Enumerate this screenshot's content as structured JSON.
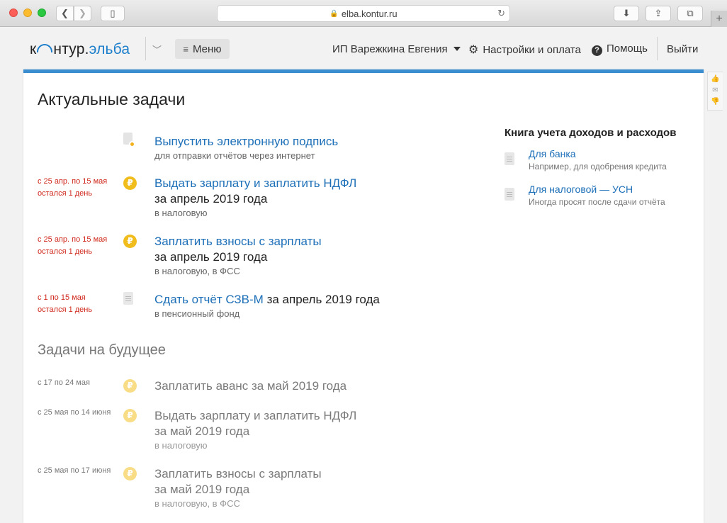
{
  "browser": {
    "url": "elba.kontur.ru",
    "new_tab": "+"
  },
  "header": {
    "logo_part1": "к",
    "logo_part2": "нтур.",
    "logo_part3": "эльба",
    "menu_label": "Меню",
    "user_label": "ИП Варежкина Евгения",
    "settings_label": "Настройки и оплата",
    "help_label": "Помощь",
    "logout_label": "Выйти"
  },
  "main": {
    "title": "Актуальные задачи",
    "tasks": [
      {
        "link": "Выпустить электронную подпись",
        "sub": "для отправки отчётов через интернет"
      },
      {
        "deadline1": "с 25 апр. по 15 мая",
        "deadline2": "остался 1 день",
        "link": "Выдать зарплату и заплатить НДФЛ",
        "main": "за апрель 2019 года",
        "sub": "в налоговую"
      },
      {
        "deadline1": "с 25 апр. по 15 мая",
        "deadline2": "остался 1 день",
        "link": "Заплатить взносы с зарплаты",
        "main": "за апрель 2019 года",
        "sub": "в налоговую, в ФСС"
      },
      {
        "deadline1": "с 1 по 15 мая",
        "deadline2": "остался 1 день",
        "link": "Сдать отчёт СЗВ-М",
        "main_inline": " за апрель 2019 года",
        "sub": "в пенсионный фонд"
      }
    ],
    "future_title": "Задачи на будущее",
    "future_tasks": [
      {
        "deadline": "с 17 по 24 мая",
        "link": "Заплатить аванс за май 2019 года"
      },
      {
        "deadline": "с 25 мая по 14 июня",
        "link": "Выдать зарплату и заплатить НДФЛ",
        "main": "за май 2019 года",
        "sub": "в налоговую"
      },
      {
        "deadline": "с 25 мая по 17 июня",
        "link": "Заплатить взносы с зарплаты",
        "main": "за май 2019 года",
        "sub": "в налоговую, в ФСС"
      }
    ]
  },
  "ledger": {
    "title": "Книга учета доходов и расходов",
    "items": [
      {
        "title": "Для банка",
        "sub": "Например, для одобрения кредита"
      },
      {
        "title": "Для налоговой — УСН",
        "sub": "Иногда просят после сдачи отчёта"
      }
    ]
  },
  "colors": {
    "accent": "#1d6fb8",
    "deadline_red": "#d0281c",
    "ruble_yellow": "#f0bd1c",
    "card_top": "#3a8ed0"
  },
  "icons": {
    "ruble": "₽"
  }
}
